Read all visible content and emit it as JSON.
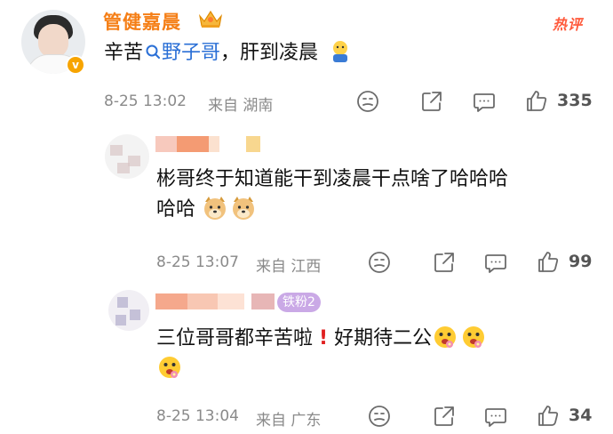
{
  "main_comment": {
    "username": "管健嘉晨",
    "hot_label": "热评",
    "text_prefix": "辛苦",
    "mention": "野子哥",
    "text_suffix": "，肝到凌晨",
    "date": "8-25 13:02",
    "source": "来自 湖南",
    "like_count": "335"
  },
  "replies": [
    {
      "text_line1": "彬哥终于知道能干到凌晨干点啥了哈哈哈",
      "text_line2": "哈哈",
      "date": "8-25 13:07",
      "source": "来自 江西",
      "like_count": "99"
    },
    {
      "badge": "铁粉2",
      "text_line1": "三位哥哥都辛苦啦",
      "text_mid": "好期待二公",
      "date": "8-25 13:04",
      "source": "来自 广东",
      "like_count": "34"
    }
  ],
  "colors": {
    "username": "#f57f17",
    "mention": "#2a6fd6",
    "hot": "#ff5a3c",
    "meta": "#8a8a8a"
  },
  "icons": [
    "crown-icon",
    "verified-badge-icon",
    "search-icon",
    "dislike-icon",
    "share-icon",
    "comment-icon",
    "like-icon",
    "doge-emoji",
    "exclamation-emoji",
    "flower-emoji"
  ]
}
